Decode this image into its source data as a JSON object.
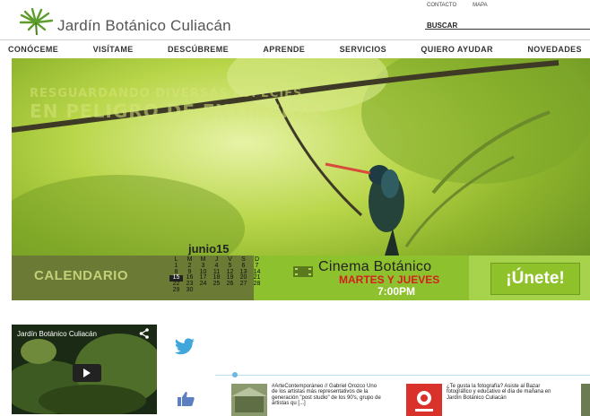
{
  "header": {
    "site_name": "Jardín Botánico Culiacán",
    "utility_links": [
      "CONTACTO",
      "MAPA"
    ],
    "search_placeholder": "BUSCAR"
  },
  "nav": {
    "items": [
      "CONÓCEME",
      "VISÍTAME",
      "DESCÚBREME",
      "APRENDE",
      "SERVICIOS",
      "QUIERO AYUDAR",
      "NOVEDADES"
    ]
  },
  "hero": {
    "title_line1": "RESGUARDANDO DIVERSAS ESPECIES",
    "title_line2": "EN PELIGRO DE EXTINCIÓN"
  },
  "calendar": {
    "label": "CALENDARIO",
    "month": "junio15",
    "weekdays": [
      "L",
      "M",
      "M",
      "J",
      "V",
      "S",
      "D"
    ],
    "weeks": [
      [
        "1",
        "2",
        "3",
        "4",
        "5",
        "6",
        "7"
      ],
      [
        "8",
        "9",
        "10",
        "11",
        "12",
        "13",
        "14"
      ],
      [
        "15",
        "16",
        "17",
        "18",
        "19",
        "20",
        "21"
      ],
      [
        "22",
        "23",
        "24",
        "25",
        "26",
        "27",
        "28"
      ],
      [
        "29",
        "30",
        "",
        "",
        "",
        "",
        ""
      ]
    ],
    "highlighted_day": "15"
  },
  "cinema": {
    "title": "Cinema Botánico",
    "days": "MARTES Y JUEVES",
    "time": "7:00PM"
  },
  "join_button": "¡Únete!",
  "video": {
    "title": "Jardín Botánico Culiacán"
  },
  "posts": [
    {
      "text": "#ArteContemporáneo // Gabriel Orozco Uno de los artistas más representativos de la generación \"post studio\" de los 90's, grupo de artistas qu [...]"
    },
    {
      "text": "¿Te gusta la fotografía? Asiste al Bazar fotográfico y educativo el día de mañana en Jardín Botánico Culiacán"
    }
  ],
  "colors": {
    "hero_green": "#b9d64a",
    "calendar_bg": "#6b7a34",
    "cinema_bg": "#8ec12e",
    "cinema_red": "#d41f1f",
    "join_bg": "#a6d24c",
    "twitter_blue": "#3fa7dc",
    "like_blue": "#5b7fbf"
  },
  "icons": [
    "palm-logo-icon",
    "share-icon",
    "play-icon",
    "twitter-icon",
    "like-icon",
    "cinema-icon"
  ]
}
